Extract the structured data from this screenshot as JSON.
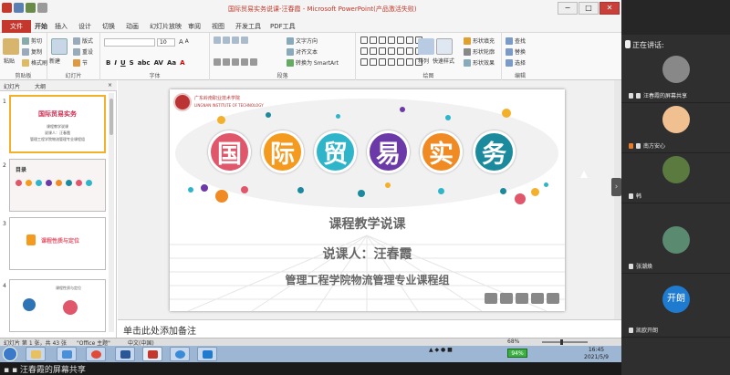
{
  "window": {
    "title": "国际贸易实务说课-汪春霞  -  Microsoft PowerPoint(产品激活失败)",
    "controls": [
      "−",
      "□",
      "✕"
    ]
  },
  "ribbon_tabs": [
    {
      "label": "文件"
    },
    {
      "label": "开始"
    },
    {
      "label": "插入"
    },
    {
      "label": "设计"
    },
    {
      "label": "切换"
    },
    {
      "label": "动画"
    },
    {
      "label": "幻灯片放映"
    },
    {
      "label": "审阅"
    },
    {
      "label": "视图"
    },
    {
      "label": "开发工具"
    },
    {
      "label": "PDF工具"
    }
  ],
  "ribbon": {
    "clipboard": {
      "cut": "剪切",
      "copy": "复制",
      "painter": "格式刷",
      "paste": "粘贴",
      "label": "剪贴板"
    },
    "slides": {
      "new": "新建\n幻灯片",
      "layout": "版式",
      "reset": "重设",
      "section": "节",
      "label": "幻灯片"
    },
    "font": {
      "size": "10",
      "label": "字体",
      "bold": "B",
      "italic": "I",
      "underline": "U",
      "strike": "S",
      "shadow": "abc",
      "spacing": "AV",
      "case": "Aa",
      "color": "A"
    },
    "paragraph": {
      "direction": "文字方向",
      "align": "对齐文本",
      "smartart": "转换为 SmartArt",
      "label": "段落"
    },
    "drawing": {
      "arrange": "排列",
      "styles": "快速样式",
      "fill": "形状填充",
      "outline": "形状轮廓",
      "effect": "形状效果",
      "label": "绘图"
    },
    "editing": {
      "find": "查找",
      "replace": "替换",
      "select": "选择",
      "label": "编辑"
    }
  },
  "panel": {
    "tab_slides": "幻灯片",
    "tab_outline": "大纲",
    "close": "×",
    "thumbs": [
      {
        "num": "1",
        "title": "国际贸易实务",
        "line1": "课程教学说课",
        "line2": "说课人：汪春霞",
        "line3": "管理工程学院物流管理专业课程组"
      },
      {
        "num": "2",
        "title": "目录"
      },
      {
        "num": "3",
        "title": "课程性质与定位"
      },
      {
        "num": "4",
        "title": "课程性质与定位"
      }
    ]
  },
  "slide": {
    "school_name": "广东岭南职业技术学院",
    "school_name_en": "LINGNAN INSTITUTE OF TECHNOLOGY",
    "title_chars": [
      {
        "char": "国",
        "color": "#e0566a"
      },
      {
        "char": "际",
        "color": "#f39a1f"
      },
      {
        "char": "贸",
        "color": "#2fb5c9"
      },
      {
        "char": "易",
        "color": "#6b3aa8"
      },
      {
        "char": "实",
        "color": "#f08a23"
      },
      {
        "char": "务",
        "color": "#1b8a9c"
      }
    ],
    "line1": "课程教学说课",
    "line2": "说课人：汪春霞",
    "line3": "管理工程学院物流管理专业课程组"
  },
  "notes_placeholder": "单击此处添加备注",
  "status": {
    "slide_pos": "幻灯片 第 1 张，共 43 张",
    "theme": "\"Office 主题\"",
    "lang": "中文(中国)",
    "zoom": "68%"
  },
  "taskbar": {
    "battery": "94%",
    "time": "16:45",
    "date": "2021/5/9"
  },
  "share_label": "汪春霞的屏幕共享",
  "meeting": {
    "speaking_label": "正在讲话:",
    "participants": [
      {
        "name": "汪春霞的屏幕共享",
        "avatar_color": "#ddd"
      },
      {
        "name": "南方安心",
        "avatar_color": "#f0c090"
      },
      {
        "name": "韩",
        "avatar_color": "#5a7a40"
      },
      {
        "name": "张潮焕",
        "avatar_color": "#5a8a70"
      },
      {
        "name": "凯欧开朗",
        "avatar_color": "#1e7bd0",
        "avatar_text": "开朗"
      }
    ]
  }
}
